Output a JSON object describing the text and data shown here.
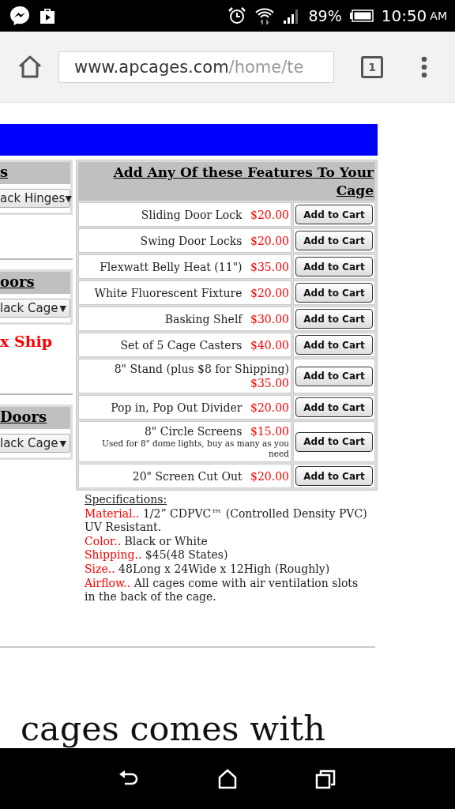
{
  "status_bar": {
    "battery": "89%",
    "time": "10:50",
    "ampm": "AM"
  },
  "browser": {
    "url_domain": "www.apcages.com",
    "url_path": "/home/te",
    "tab_count": "1"
  },
  "left_column": [
    {
      "kind": "panel",
      "heading": "s",
      "select": "ack Hinges",
      "arrow": "▼"
    },
    {
      "kind": "rule"
    },
    {
      "kind": "panel",
      "heading": "oors",
      "select": "lack Cage",
      "arrow": "▼"
    },
    {
      "kind": "notice",
      "text": "x Ship"
    },
    {
      "kind": "rule"
    },
    {
      "kind": "panel",
      "heading": "Doors",
      "select": "lack Cage",
      "arrow": "▼"
    }
  ],
  "features": {
    "heading": "Add Any Of these Features To Your Cage",
    "items": [
      {
        "name": "Sliding Door Lock",
        "price": "$20.00",
        "button": "Add to Cart"
      },
      {
        "name": "Swing Door Locks",
        "price": "$20.00",
        "button": "Add to Cart"
      },
      {
        "name": "Flexwatt Belly Heat (11\")",
        "price": "$35.00",
        "button": "Add to Cart"
      },
      {
        "name": "White Fluorescent Fixture",
        "price": "$20.00",
        "button": "Add to Cart"
      },
      {
        "name": "Basking Shelf",
        "price": "$30.00",
        "button": "Add to Cart"
      },
      {
        "name": "Set of 5 Cage Casters",
        "price": "$40.00",
        "button": "Add to Cart"
      },
      {
        "name": "8\" Stand (plus $8 for Shipping)",
        "price": "$35.00",
        "button": "Add to Cart"
      },
      {
        "name": "Pop in, Pop Out Divider",
        "price": "$20.00",
        "button": "Add to Cart"
      },
      {
        "name": "8\" Circle Screens",
        "price": "$15.00",
        "note": "Used for 8\" dome lights, buy as many as you need",
        "button": "Add to Cart"
      },
      {
        "name": "20\" Screen Cut Out",
        "price": "$20.00",
        "button": "Add to Cart"
      }
    ]
  },
  "specs": {
    "title": "Specifications:",
    "lines": [
      {
        "label": "Material..",
        "text": "1/2” CDPVC™ (Controlled Density PVC) UV Resistant."
      },
      {
        "label": "Color..",
        "text": "Black or White"
      },
      {
        "label": "Shipping..",
        "text": "$45(48 States)"
      },
      {
        "label": "Size..",
        "text": "48Long x 24Wide x 12High (Roughly)"
      },
      {
        "label": "Airflow..",
        "text": "All cages come with air ventilation slots in the back of the cage."
      }
    ]
  },
  "footer_text": "cages comes with"
}
